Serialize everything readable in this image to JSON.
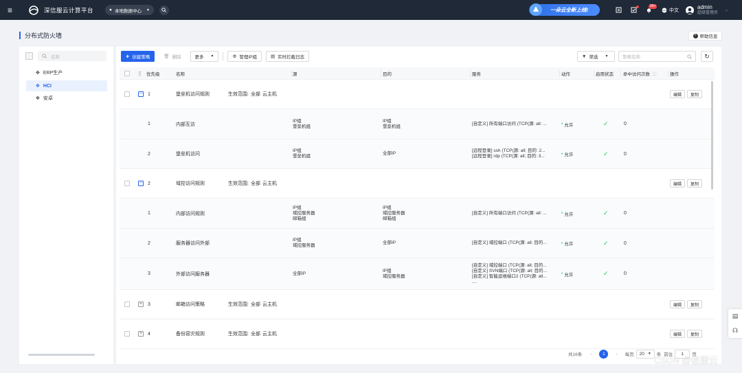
{
  "topbar": {
    "brand": "深信服云计算平台",
    "datacenter": "本地数据中心",
    "promo": "一朵云全新上线!",
    "notification_count": "99+",
    "language": "中文",
    "user_name": "admin",
    "user_role": "超级管理员"
  },
  "page": {
    "title": "分布式防火墙",
    "help": "帮助信息"
  },
  "left_panel": {
    "search_placeholder": "名称",
    "tree": [
      {
        "label": "ERP生产",
        "active": false
      },
      {
        "label": "HCI",
        "active": true
      },
      {
        "label": "安卓",
        "active": false
      }
    ]
  },
  "toolbar": {
    "create": "创建策略",
    "delete": "删除",
    "more": "更多",
    "manage_ip": "管理IP组",
    "realtime_log": "实时拦截日志",
    "filter": "筛选",
    "search_placeholder": "策略名称"
  },
  "table": {
    "headers": {
      "priority": "优先级",
      "name": "名称",
      "source": "源",
      "dest": "目的",
      "service": "服务",
      "action": "动作",
      "enabled": "启用状态",
      "hits": "命中访问次数",
      "ops": "操作"
    },
    "scope_label": "生效范围:",
    "scope_all": "全部",
    "scope_host": "云主机",
    "edit": "编辑",
    "copy": "复制",
    "groups": [
      {
        "priority": "1",
        "name": "堡垒机访问规则",
        "expanded": true,
        "rules": [
          {
            "priority": "1",
            "name": "内部互访",
            "source": [
              "IP组",
              "堡垒机组"
            ],
            "dest": [
              "IP组",
              "堡垒机组"
            ],
            "service": [
              "[自定义] 所有端口访问 (TCP(源: all: ..."
            ],
            "action": "允许",
            "hits": "0"
          },
          {
            "priority": "2",
            "name": "堡垒机访问",
            "source": [
              "IP组",
              "堡垒机组"
            ],
            "dest": [
              "全部IP"
            ],
            "service": [
              "[远程登录] ssh (TCP(源: all; 目的: 2...",
              "[远程登录] rdp (TCP(源: all; 目的: 3..."
            ],
            "action": "允许",
            "hits": "0"
          }
        ]
      },
      {
        "priority": "2",
        "name": "域控访问规则",
        "expanded": true,
        "rules": [
          {
            "priority": "1",
            "name": "内部访问规则",
            "source": [
              "IP组",
              "域控服务器",
              "邮箱组"
            ],
            "dest": [
              "IP组",
              "域控服务器",
              "邮箱组"
            ],
            "service": [
              "[自定义] 所有端口访问 (TCP(源: all: ..."
            ],
            "action": "允许",
            "hits": "0"
          },
          {
            "priority": "2",
            "name": "服务器访问外部",
            "source": [
              "IP组",
              "域控服务器"
            ],
            "dest": [
              "全部IP"
            ],
            "service": [
              "[自定义] 域控端口 (TCP(源: all; 目的..."
            ],
            "action": "允许",
            "hits": "0"
          },
          {
            "priority": "3",
            "name": "外部访问服务器",
            "source": [
              "全部IP"
            ],
            "dest": [
              "IP组",
              "域控服务器"
            ],
            "service": [
              "[自定义] 域控端口 (TCP(源: all; 目的...",
              "[自定义] SVN端口 (TCP(源: all; 目的...",
              "[自定义] 智能运维端口2 (TCP(源: all...",
              "...."
            ],
            "action": "允许",
            "hits": "0"
          }
        ]
      },
      {
        "priority": "3",
        "name": "邮箱访问策略",
        "expanded": false,
        "rules": []
      },
      {
        "priority": "4",
        "name": "备份容灾规则",
        "expanded": false,
        "rules": []
      }
    ]
  },
  "pagination": {
    "total": "共16条",
    "current": "1",
    "per_page_label": "每页",
    "per_page": "20",
    "per_page_unit": "条",
    "goto_label": "前往",
    "goto_value": "1",
    "page_unit": "页"
  },
  "watermark": "CSDN @信服云"
}
